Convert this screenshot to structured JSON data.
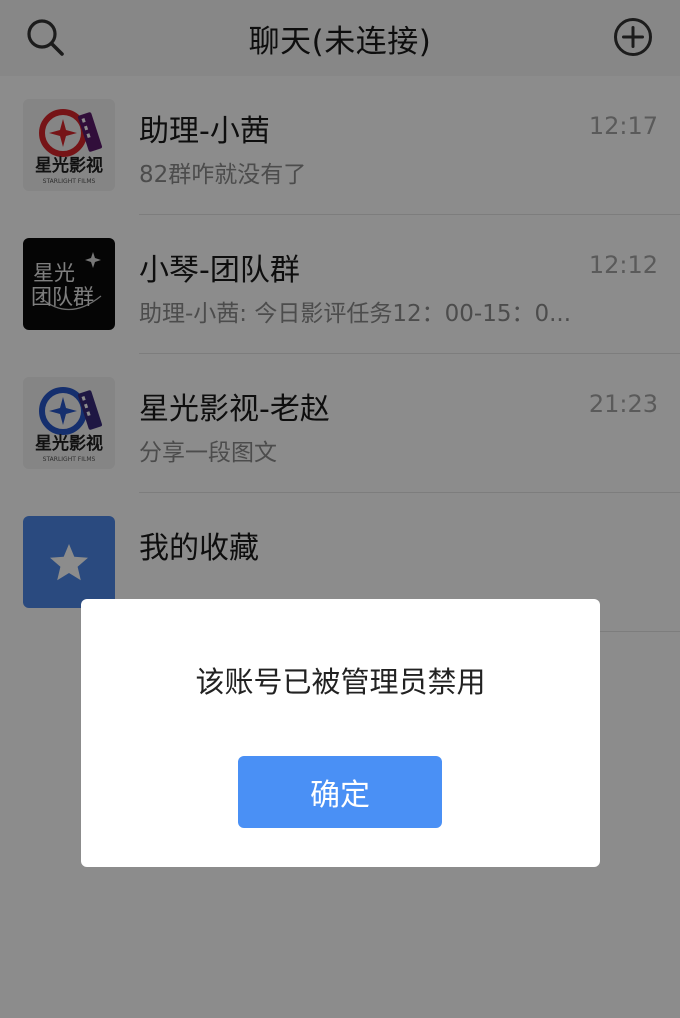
{
  "header": {
    "title": "聊天(未连接)",
    "search_icon": "search-icon",
    "add_icon": "plus-circle-icon"
  },
  "chats": [
    {
      "name": "助理-小茜",
      "preview": "82群咋就没有了",
      "time": "12:17",
      "avatar": {
        "type": "logo",
        "text": "星光影视",
        "subtext": "STARLIGHT FILMS",
        "accent": "#d8262a"
      }
    },
    {
      "name": "小琴-团队群",
      "preview": "助理-小茜: 今日影评任务12：00-15：0...",
      "time": "12:12",
      "avatar": {
        "type": "text",
        "line1": "星光",
        "line2": "团队群"
      }
    },
    {
      "name": "星光影视-老赵",
      "preview": "分享一段图文",
      "time": "21:23",
      "avatar": {
        "type": "logo",
        "text": "星光影视",
        "subtext": "STARLIGHT FILMS",
        "accent": "#2756c8"
      }
    },
    {
      "name": "我的收藏",
      "preview": "",
      "time": "",
      "avatar": {
        "type": "star",
        "icon": "star-icon",
        "color": "#4d88e8"
      }
    }
  ],
  "dialog": {
    "message": "该账号已被管理员禁用",
    "confirm_label": "确定"
  },
  "colors": {
    "primary_button": "#4a90f5",
    "overlay": "rgba(0,0,0,0.45)"
  }
}
